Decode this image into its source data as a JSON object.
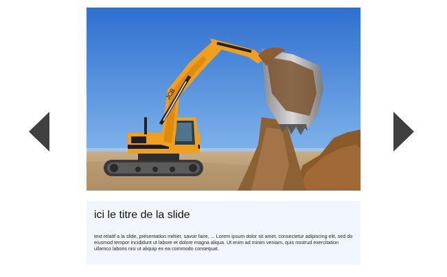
{
  "slider": {
    "slide": {
      "title": "ici le titre de la slide",
      "text": "text relatif a la slide, présentation métier, savoir faire, ... Lorem ipsum dolor sit amet, consectetur adipiscing elit, sed do eiusmod tempor incididunt ut labore et dolore magna aliqua. Ut enim ad minim veniam, quis nostrud exercitation ullamco laboris nisi ut aliquip ex ea commodo consequat."
    },
    "icons": {
      "prev": "arrow-left-icon",
      "next": "arrow-right-icon"
    },
    "colors": {
      "arrow": "#404040",
      "caption_bg": "#f1f6fd",
      "sky": "#3f7fd6",
      "excavator": "#f0a020"
    }
  }
}
